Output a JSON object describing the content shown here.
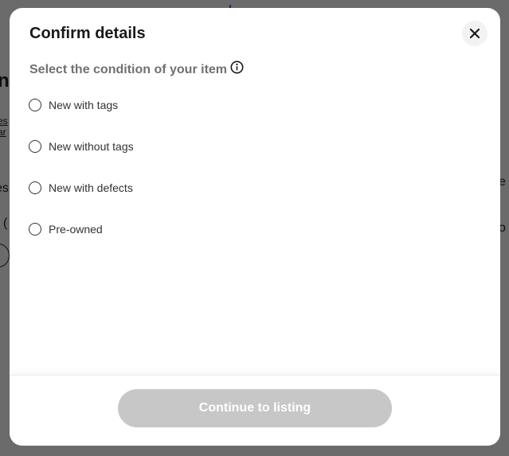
{
  "background_page": {
    "fragments": [
      "n",
      "es",
      "ar",
      "es",
      "e",
      "(",
      "o"
    ]
  },
  "dialog": {
    "title": "Confirm details",
    "close_icon": "close-icon",
    "condition": {
      "label": "Select the condition of your item",
      "info_icon": "info-icon",
      "options": [
        {
          "label": "New with tags",
          "selected": false
        },
        {
          "label": "New without tags",
          "selected": false
        },
        {
          "label": "New with defects",
          "selected": false
        },
        {
          "label": "Pre-owned",
          "selected": false
        }
      ]
    },
    "footer": {
      "continue_label": "Continue to listing",
      "continue_disabled": true
    }
  },
  "colors": {
    "scrim": "#000000",
    "title_text": "#191919",
    "label_text": "#707070",
    "disabled_button": "#c7c7c7"
  }
}
